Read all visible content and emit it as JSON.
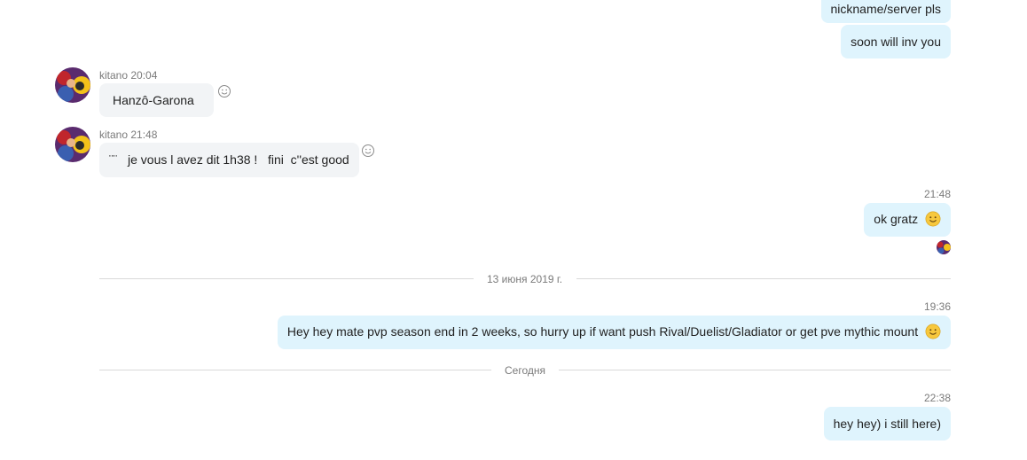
{
  "conversation": {
    "messages": [
      {
        "text": "nickname/server pls"
      },
      {
        "text": "soon will inv you"
      },
      {
        "sender": "kitano",
        "time": "20:04",
        "text": "Hanzô-Garona"
      },
      {
        "sender": "kitano",
        "time": "21:48",
        "text": "¨¨   je vous l avez dit 1h38 !   fini  c''est good"
      },
      {
        "time": "21:48",
        "text": "ok gratz",
        "emoji": "smiley-emoji"
      },
      {
        "time": "19:36",
        "text": "Hey hey mate pvp season end in 2 weeks, so hurry up if want push Rival/Duelist/Gladiator or get pve mythic mount",
        "emoji": "smiley-emoji"
      },
      {
        "time": "22:38",
        "text": "hey hey) i still here)"
      }
    ],
    "dividers": [
      {
        "label": "13 июня 2019 г."
      },
      {
        "label": "Сегодня"
      }
    ],
    "icons": {
      "avatar": "anime-avatar-icon",
      "reaction": "add-reaction-smiley-icon",
      "read_receipt": "read-receipt-avatar-icon"
    },
    "colors": {
      "outgoing_bubble": "#dff4fd",
      "incoming_bubble": "#f2f4f6",
      "meta_text": "#7a7a7a",
      "divider": "#d9d9d9"
    }
  }
}
